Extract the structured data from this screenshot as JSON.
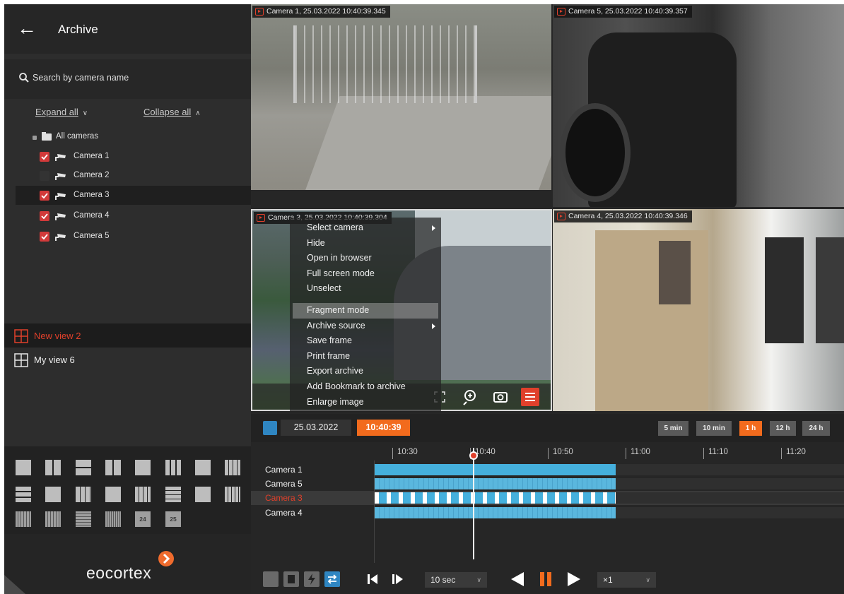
{
  "sidebar": {
    "title": "Archive",
    "search_placeholder": "Search by camera name",
    "expand_all": "Expand all",
    "collapse_all": "Collapse all",
    "root_label": "All cameras",
    "cameras": [
      {
        "label": "Camera 1",
        "checked": true
      },
      {
        "label": "Camera 2",
        "checked": false
      },
      {
        "label": "Camera 3",
        "checked": true
      },
      {
        "label": "Camera 4",
        "checked": true
      },
      {
        "label": "Camera 5",
        "checked": true
      }
    ],
    "views": [
      {
        "label": "New view 2",
        "active": true
      },
      {
        "label": "My view 6",
        "active": false
      }
    ],
    "layout_numbers": [
      "24",
      "25"
    ],
    "brand": "eocortex"
  },
  "tiles": {
    "cam1": "Camera 1, 25.03.2022 10:40:39.345",
    "cam5": "Camera 5, 25.03.2022 10:40:39.357",
    "cam3": "Camera 3, 25.03.2022 10:40:39.304",
    "cam4": "Camera 4, 25.03.2022 10:40:39.346"
  },
  "context_menu": [
    "Select camera",
    "Hide",
    "Open in browser",
    "Full screen mode",
    "Unselect",
    "Fragment mode",
    "Archive source",
    "Save frame",
    "Print frame",
    "Export archive",
    "Add Bookmark to archive",
    "Enlarge image"
  ],
  "timeline": {
    "date": "25.03.2022",
    "time": "10:40:39",
    "scales": [
      "5 min",
      "10 min",
      "1 h",
      "12 h",
      "24 h"
    ],
    "active_scale": "1 h",
    "ticks": [
      "10:30",
      "10:40",
      "10:50",
      "11:00",
      "11:10",
      "11:20"
    ],
    "rows": [
      "Camera 1",
      "Camera 5",
      "Camera 3",
      "Camera 4"
    ],
    "selected_row": "Camera 3",
    "step": "10 sec",
    "speed": "×1"
  },
  "colors": {
    "accent": "#f26b1d",
    "selection_red": "#e0402b",
    "archive_bar": "#45b0dd"
  }
}
